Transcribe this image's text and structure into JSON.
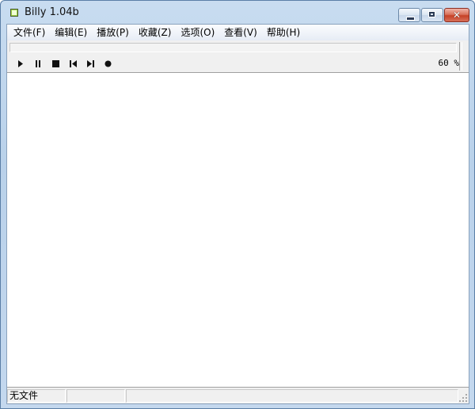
{
  "window": {
    "title": "Billy 1.04b"
  },
  "menu": [
    {
      "label": "文件(F)"
    },
    {
      "label": "编辑(E)"
    },
    {
      "label": "播放(P)"
    },
    {
      "label": "收藏(Z)"
    },
    {
      "label": "选项(O)"
    },
    {
      "label": "查看(V)"
    },
    {
      "label": "帮助(H)"
    }
  ],
  "controls": {
    "volume": "60 %",
    "icons": [
      "play-icon",
      "pause-icon",
      "stop-icon",
      "previous-icon",
      "next-icon",
      "record-icon"
    ]
  },
  "status": {
    "file": "无文件"
  },
  "colors": {
    "titlebar": "#b9d1ea",
    "client": "#f0f0f0",
    "close_button": "#c64126"
  }
}
